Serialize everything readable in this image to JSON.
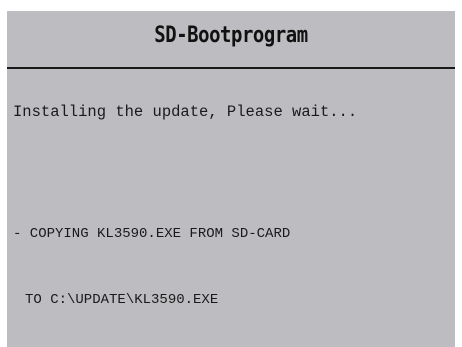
{
  "header": {
    "title": "SD-Bootprogram"
  },
  "main": {
    "status_message": "Installing the update, Please wait...",
    "log": [
      "- COPYING KL3590.EXE FROM SD-CARD",
      "TO C:\\UPDATE\\KL3590.EXE"
    ]
  },
  "colors": {
    "screen_background": "#bdbdc1",
    "text": "#1a1a1a",
    "divider": "#1a1a1a"
  }
}
